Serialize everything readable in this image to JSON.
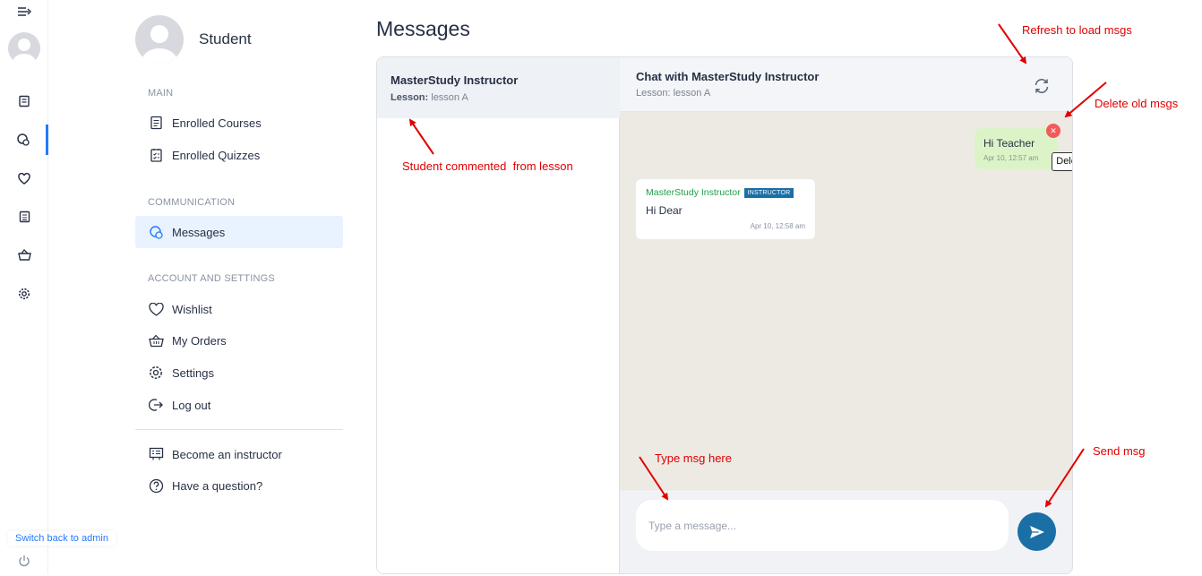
{
  "profile": {
    "name": "Student"
  },
  "nav": {
    "sections": {
      "main": "MAIN",
      "communication": "COMMUNICATION",
      "account": "ACCOUNT AND SETTINGS"
    },
    "items": {
      "enrolled_courses": "Enrolled Courses",
      "enrolled_quizzes": "Enrolled Quizzes",
      "messages": "Messages",
      "wishlist": "Wishlist",
      "my_orders": "My Orders",
      "settings": "Settings",
      "log_out": "Log out",
      "become_instructor": "Become an instructor",
      "have_question": "Have a question?"
    },
    "active": "messages"
  },
  "rail": {
    "switch_admin": "Switch back to admin",
    "icons": [
      "menu-toggle-icon",
      "courses-icon",
      "messages-icon",
      "heart-icon",
      "quiz-icon",
      "basket-icon",
      "gear-icon",
      "power-icon"
    ]
  },
  "page": {
    "title": "Messages"
  },
  "conversation": {
    "name": "MasterStudy Instructor",
    "lesson_label": "Lesson:",
    "lesson_value": "lesson A"
  },
  "chat": {
    "title": "Chat with MasterStudy Instructor",
    "lesson_line": "Lesson: lesson A",
    "messages": [
      {
        "text": "Hi Teacher",
        "time": "Apr 10, 12:57 am",
        "own": true
      },
      {
        "sender": "MasterStudy Instructor",
        "badge": "INSTRUCTOR",
        "text": "Hi Dear",
        "time": "Apr 10, 12:58 am",
        "own": false
      }
    ],
    "delete_tooltip": "Delete message",
    "input_placeholder": "Type a message..."
  },
  "annotations": {
    "refresh": "Refresh to load msgs",
    "delete": "Delete old msgs",
    "student": "Student commented  from lesson",
    "type": "Type msg here",
    "send": "Send msg"
  },
  "colors": {
    "accent": "#227aff",
    "send_button": "#1a6fa6",
    "own_bubble": "#dcf3c8",
    "chat_background": "#edeae4",
    "delete_button": "#f25a5a",
    "annotation": "#e00000"
  }
}
